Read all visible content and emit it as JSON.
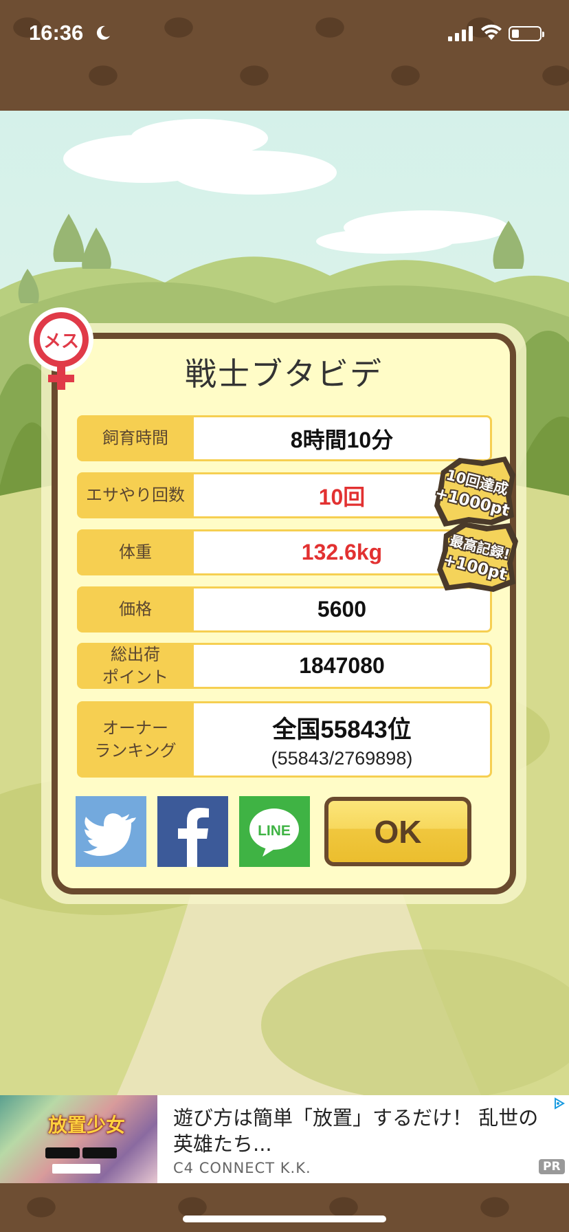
{
  "status_bar": {
    "time": "16:36",
    "battery_level": 0.25
  },
  "dialog": {
    "title": "戦士ブタビデ",
    "gender_badge": "メス",
    "rows": [
      {
        "label": "飼育時間",
        "value": "8時間10分"
      },
      {
        "label": "エサやり回数",
        "value": "10回"
      },
      {
        "label": "体重",
        "value": "132.6kg"
      },
      {
        "label": "価格",
        "value": "5600"
      },
      {
        "label": "総出荷\nポイント",
        "value": "1847080"
      }
    ],
    "ranking": {
      "label": "オーナー\nランキング",
      "rank": "全国55843位",
      "detail": "(55843/2769898)"
    },
    "stamps": [
      {
        "line1": "10回達成",
        "line2": "+1000pt"
      },
      {
        "line1": "最高記録!",
        "line2": "+100pt"
      }
    ],
    "share": {
      "twitter_icon": "twitter-bird",
      "facebook_icon": "facebook-f",
      "line_label": "LINE"
    },
    "ok_label": "OK"
  },
  "ad": {
    "image_text": "放置少女",
    "headline": "遊び方は簡単「放置」するだけ！ 乱世の英雄たち...",
    "advertiser": "C4 CONNECT K.K.",
    "badge": "PR"
  },
  "colors": {
    "frame": "#6a4a2e",
    "label_bg": "#f6cf51",
    "highlight": "#e23131",
    "panel": "#fffcc7"
  }
}
